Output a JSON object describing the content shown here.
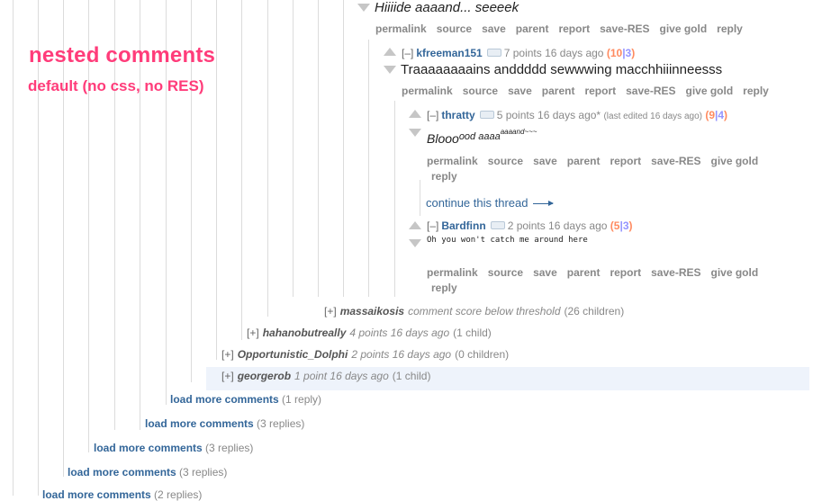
{
  "overlay": {
    "title": "nested comments",
    "subtitle": "default (no css, no RES)"
  },
  "top_comment": {
    "body": "Hiiiide aaaand... seeeek",
    "buttons": [
      "permalink",
      "source",
      "save",
      "parent",
      "report",
      "save-RES",
      "give gold",
      "reply"
    ]
  },
  "kfreeman": {
    "toggle": "[–]",
    "author": "kfreeman151",
    "score": "7 points 16 days ago",
    "votes_open": "(",
    "ups": "10",
    "sep": "|",
    "downs": "3",
    "votes_close": ")",
    "body": "Traaaaaaaains anddddd sewwwing macchhiiinneesss",
    "buttons": [
      "permalink",
      "source",
      "save",
      "parent",
      "report",
      "save-RES",
      "give gold",
      "reply"
    ]
  },
  "thratty": {
    "toggle": "[–]",
    "author": "thratty",
    "score": "5 points 16 days ago*",
    "edited": "(last edited 16 days ago)",
    "votes_open": "(",
    "ups": "9",
    "sep": "|",
    "downs": "4",
    "votes_close": ")",
    "body_main": "Blooo",
    "body_sup1": "ood aaaa",
    "body_sup2": "aaaand~~~",
    "buttons_line1": [
      "permalink",
      "source",
      "save",
      "parent",
      "report",
      "save-RES",
      "give gold"
    ],
    "buttons_line2": [
      "reply"
    ]
  },
  "continue_thread": "continue this thread",
  "bardfinn": {
    "toggle": "[–]",
    "author": "Bardfinn",
    "score": "2 points 16 days ago",
    "votes_open": "(",
    "ups": "5",
    "sep": "|",
    "downs": "3",
    "votes_close": ")",
    "body": "Oh you won't catch me around here",
    "buttons_line1": [
      "permalink",
      "source",
      "save",
      "parent",
      "report",
      "save-RES",
      "give gold"
    ],
    "buttons_line2": [
      "reply"
    ]
  },
  "collapsed": [
    {
      "toggle": "[+]",
      "author": "massaikosis",
      "meta": "comment score below threshold",
      "children": "(26 children)"
    },
    {
      "toggle": "[+]",
      "author": "hahanobutreally",
      "meta": "4 points 16 days ago",
      "children": "(1 child)"
    },
    {
      "toggle": "[+]",
      "author": "Opportunistic_Dolphi",
      "meta": "2 points 16 days ago",
      "children": "(0 children)"
    },
    {
      "toggle": "[+]",
      "author": "georgerob",
      "meta": "1 point 16 days ago",
      "children": "(1 child)"
    }
  ],
  "load_more": [
    {
      "label": "load more comments",
      "count": "(1 reply)"
    },
    {
      "label": "load more comments",
      "count": "(3 replies)"
    },
    {
      "label": "load more comments",
      "count": "(3 replies)"
    },
    {
      "label": "load more comments",
      "count": "(3 replies)"
    },
    {
      "label": "load more comments",
      "count": "(2 replies)"
    }
  ]
}
